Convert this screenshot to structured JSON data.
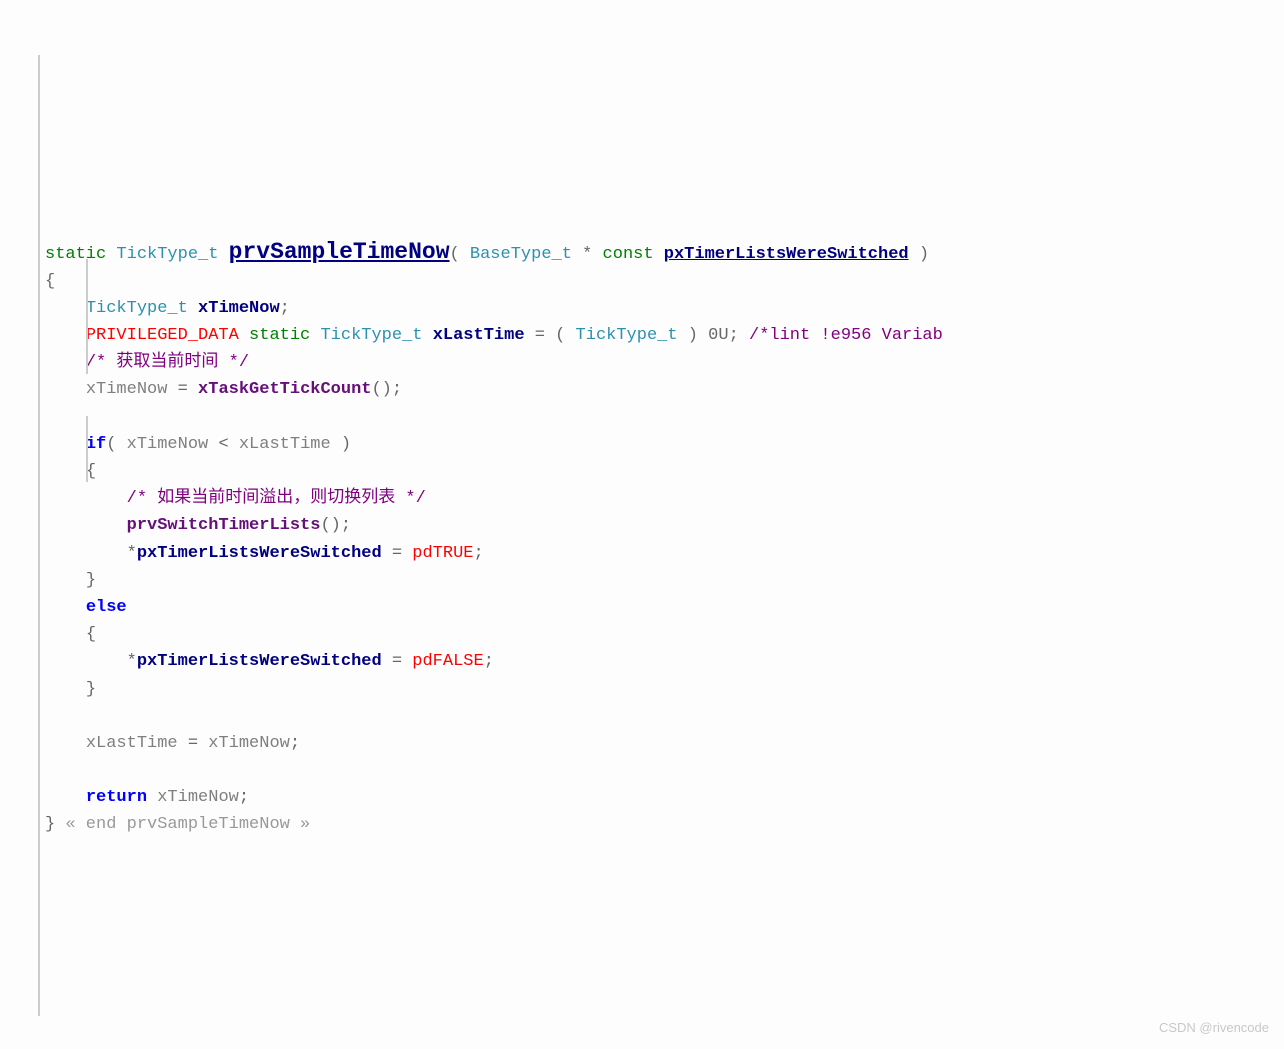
{
  "sig": {
    "static": "static",
    "type1": "TickType_t",
    "funcName": "prvSampleTimeNow",
    "paramType": "BaseType_t",
    "star": "*",
    "const": "const",
    "paramName": "pxTimerListsWereSwitched",
    "close": ")"
  },
  "openBrace": "{",
  "line1": {
    "indent": "    ",
    "type": "TickType_t",
    "var": "xTimeNow",
    "semi": ";"
  },
  "line2": {
    "indent": "    ",
    "macro": "PRIVILEGED_DATA",
    "static": "static",
    "type": "TickType_t",
    "var": "xLastTime",
    "eq": " = ( ",
    "cast": "TickType_t",
    "val": " ) 0U;",
    "comment": " /*lint !e956 Variab"
  },
  "line3": {
    "indent": "    ",
    "comment": "/* 获取当前时间 */"
  },
  "line4": {
    "indent": "    ",
    "lhs": "xTimeNow",
    "eq": " = ",
    "func": "xTaskGetTickCount",
    "tail": "();"
  },
  "line5": {
    "indent": "    ",
    "if": "if",
    "open": "( ",
    "a": "xTimeNow",
    "lt": " < ",
    "b": "xLastTime",
    "close": " )"
  },
  "line6": {
    "indent": "    ",
    "brace": "{"
  },
  "line7": {
    "indent": "        ",
    "comment": "/* 如果当前时间溢出，则切换列表 */"
  },
  "line8": {
    "indent": "        ",
    "func": "prvSwitchTimerLists",
    "tail": "();"
  },
  "line9": {
    "indent": "        ",
    "star": "*",
    "var": "pxTimerListsWereSwitched",
    "eq": " = ",
    "val": "pdTRUE",
    "semi": ";"
  },
  "line10": {
    "indent": "    ",
    "brace": "}"
  },
  "line11": {
    "indent": "    ",
    "else": "else"
  },
  "line12": {
    "indent": "    ",
    "brace": "{"
  },
  "line13": {
    "indent": "        ",
    "star": "*",
    "var": "pxTimerListsWereSwitched",
    "eq": " = ",
    "val": "pdFALSE",
    "semi": ";"
  },
  "line14": {
    "indent": "    ",
    "brace": "}"
  },
  "line15": {
    "indent": "    ",
    "lhs": "xLastTime",
    "eq": " = ",
    "rhs": "xTimeNow",
    "semi": ";"
  },
  "line16": {
    "indent": "    ",
    "return": "return",
    "var": "xTimeNow",
    "semi": ";"
  },
  "closeBrace": "}",
  "endComment": " « end prvSampleTimeNow »",
  "watermark": "CSDN @rivencode"
}
